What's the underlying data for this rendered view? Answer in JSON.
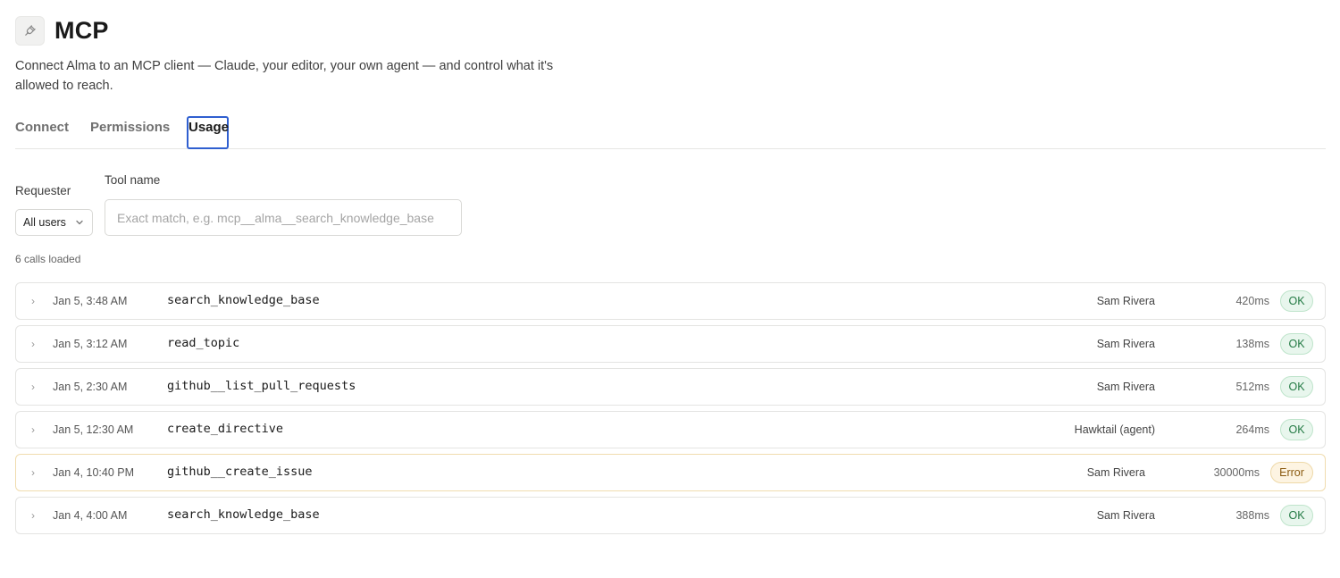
{
  "header": {
    "icon": "plug-icon",
    "title": "MCP",
    "description": "Connect Alma to an MCP client — Claude, your editor, your own agent — and control what it's allowed to reach."
  },
  "tabs": [
    {
      "label": "Connect",
      "active": false
    },
    {
      "label": "Permissions",
      "active": false
    },
    {
      "label": "Usage",
      "active": true
    }
  ],
  "filters": {
    "requester_label": "Requester",
    "requester_value": "All users",
    "tool_label": "Tool name",
    "tool_placeholder": "Exact match, e.g. mcp__alma__search_knowledge_base",
    "tool_value": ""
  },
  "calls_count": "6 calls loaded",
  "calls": [
    {
      "time": "Jan 5, 3:48 AM",
      "tool": "search_knowledge_base",
      "requester": "Sam Rivera",
      "duration": "420ms",
      "status": "OK"
    },
    {
      "time": "Jan 5, 3:12 AM",
      "tool": "read_topic",
      "requester": "Sam Rivera",
      "duration": "138ms",
      "status": "OK"
    },
    {
      "time": "Jan 5, 2:30 AM",
      "tool": "github__list_pull_requests",
      "requester": "Sam Rivera",
      "duration": "512ms",
      "status": "OK"
    },
    {
      "time": "Jan 5, 12:30 AM",
      "tool": "create_directive",
      "requester": "Hawktail (agent)",
      "duration": "264ms",
      "status": "OK"
    },
    {
      "time": "Jan 4, 10:40 PM",
      "tool": "github__create_issue",
      "requester": "Sam Rivera",
      "duration": "30000ms",
      "status": "Error"
    },
    {
      "time": "Jan 4, 4:00 AM",
      "tool": "search_knowledge_base",
      "requester": "Sam Rivera",
      "duration": "388ms",
      "status": "OK"
    }
  ],
  "colors": {
    "active_tab_outline": "#2f5fd0",
    "ok_badge_bg": "#e8f6ed",
    "ok_badge_text": "#237a44",
    "error_badge_bg": "#fdf4e2",
    "error_badge_text": "#8a5a10",
    "error_row_border": "#f0dcae"
  }
}
